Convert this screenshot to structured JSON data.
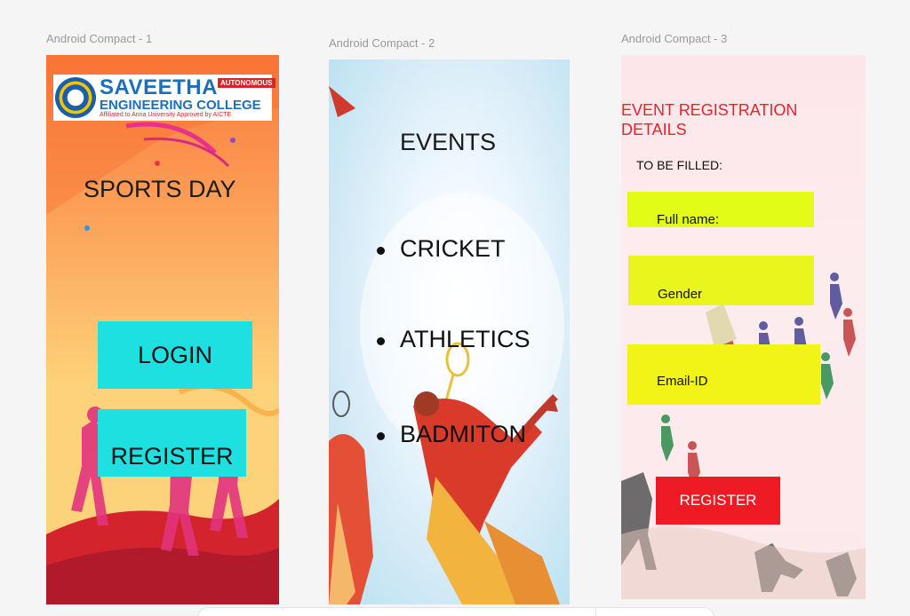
{
  "canvas": {
    "frame_labels": [
      "Android Compact - 1",
      "Android Compact - 2",
      "Android Compact - 3"
    ]
  },
  "screen1": {
    "logo": {
      "name": "SAVEETHA",
      "college": "ENGINEERING COLLEGE",
      "badge": "AUTONOMOUS",
      "affiliation": "Affiliated to Anna University  Approved by AICTE"
    },
    "title": "SPORTS DAY",
    "login_label": "LOGIN",
    "register_label": "REGISTER",
    "colors": {
      "button": "#1ee0e0",
      "background": "#fca25a"
    }
  },
  "screen2": {
    "title": "EVENTS",
    "events": [
      "CRICKET",
      "ATHLETICS",
      "BADMITON"
    ]
  },
  "screen3": {
    "heading": "EVENT REGISTRATION DETAILS",
    "subheading": "TO BE FILLED:",
    "fields": [
      "Full name:",
      "Gender",
      "Email-ID"
    ],
    "register_label": "REGISTER",
    "colors": {
      "heading": "#e8232e",
      "field": "#e8f011",
      "button": "#ee1b24"
    }
  }
}
